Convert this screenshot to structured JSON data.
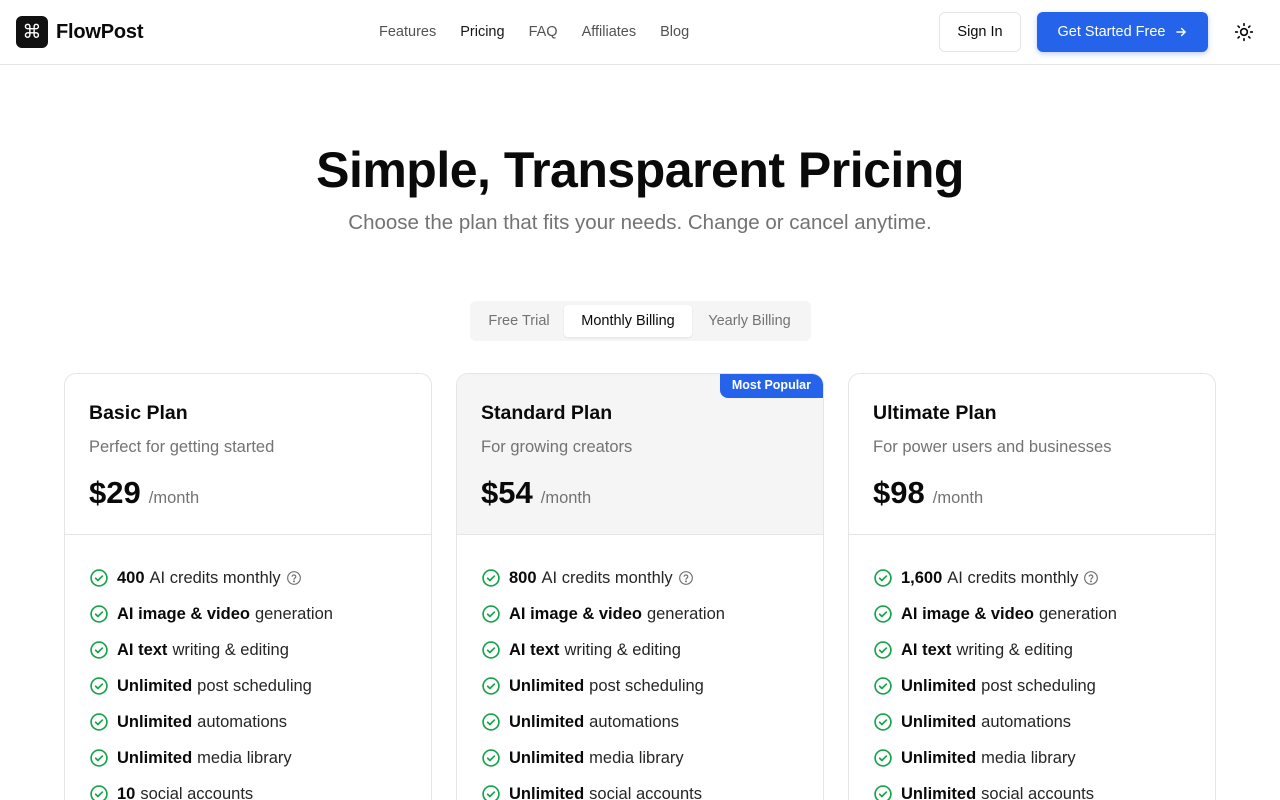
{
  "header": {
    "brand": "FlowPost",
    "nav": [
      "Features",
      "Pricing",
      "FAQ",
      "Affiliates",
      "Blog"
    ],
    "active_nav": "Pricing",
    "sign_in": "Sign In",
    "get_started": "Get Started Free",
    "icons": {
      "logo": "command-icon",
      "cta_arrow": "arrow-right-icon",
      "theme": "sun-icon"
    }
  },
  "hero": {
    "title": "Simple, Transparent Pricing",
    "subtitle": "Choose the plan that fits your needs. Change or cancel anytime."
  },
  "billing": {
    "options": [
      "Free Trial",
      "Monthly Billing",
      "Yearly Billing"
    ],
    "selected": "Monthly Billing"
  },
  "plans": [
    {
      "name": "Basic Plan",
      "description": "Perfect for getting started",
      "price": "$29",
      "period": "/month",
      "features": [
        {
          "bold": "400",
          "text": "AI credits monthly",
          "help": true
        },
        {
          "bold": "AI image & video",
          "text": "generation"
        },
        {
          "bold": "AI text",
          "text": "writing & editing"
        },
        {
          "bold": "Unlimited",
          "text": "post scheduling"
        },
        {
          "bold": "Unlimited",
          "text": "automations"
        },
        {
          "bold": "Unlimited",
          "text": "media library"
        },
        {
          "bold": "10",
          "text": "social accounts"
        }
      ]
    },
    {
      "name": "Standard Plan",
      "description": "For growing creators",
      "price": "$54",
      "period": "/month",
      "badge": "Most Popular",
      "features": [
        {
          "bold": "800",
          "text": "AI credits monthly",
          "help": true
        },
        {
          "bold": "AI image & video",
          "text": "generation"
        },
        {
          "bold": "AI text",
          "text": "writing & editing"
        },
        {
          "bold": "Unlimited",
          "text": "post scheduling"
        },
        {
          "bold": "Unlimited",
          "text": "automations"
        },
        {
          "bold": "Unlimited",
          "text": "media library"
        },
        {
          "bold": "Unlimited",
          "text": "social accounts"
        }
      ]
    },
    {
      "name": "Ultimate Plan",
      "description": "For power users and businesses",
      "price": "$98",
      "period": "/month",
      "features": [
        {
          "bold": "1,600",
          "text": "AI credits monthly",
          "help": true
        },
        {
          "bold": "AI image & video",
          "text": "generation"
        },
        {
          "bold": "AI text",
          "text": "writing & editing"
        },
        {
          "bold": "Unlimited",
          "text": "post scheduling"
        },
        {
          "bold": "Unlimited",
          "text": "automations"
        },
        {
          "bold": "Unlimited",
          "text": "media library"
        },
        {
          "bold": "Unlimited",
          "text": "social accounts"
        }
      ]
    }
  ],
  "colors": {
    "accent": "#2563eb",
    "check": "#16a34a",
    "muted_text": "#737373",
    "border": "#e5e5e5"
  }
}
